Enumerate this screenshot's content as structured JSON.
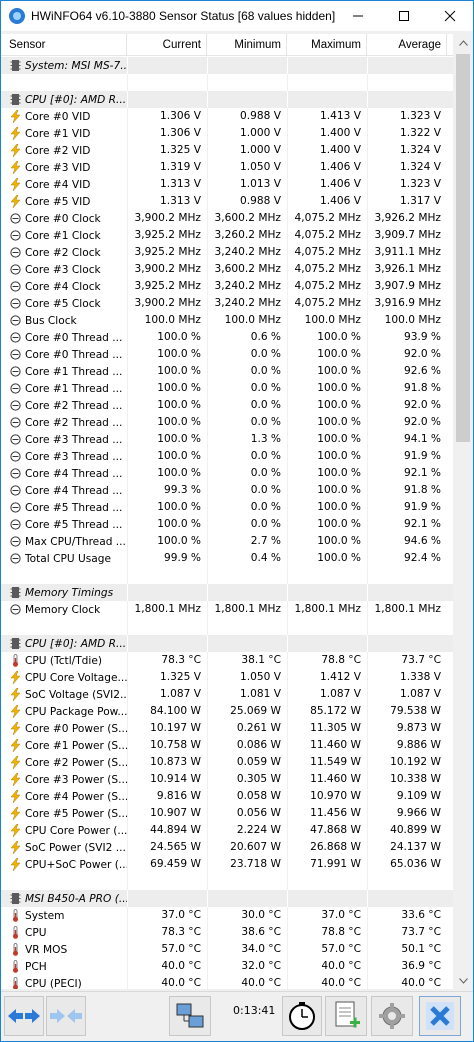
{
  "window": {
    "title": "HWiNFO64 v6.10-3880 Sensor Status [68 values hidden]",
    "minimize": "—",
    "maximize": "☐",
    "close": "✕"
  },
  "columns": {
    "sensor": "Sensor",
    "current": "Current",
    "minimum": "Minimum",
    "maximum": "Maximum",
    "average": "Average"
  },
  "rows": [
    {
      "type": "group",
      "icon": "chip-icon",
      "name": "System: MSI MS-7...",
      "cur": "",
      "min": "",
      "max": "",
      "avg": ""
    },
    {
      "type": "blank",
      "icon": "",
      "name": "",
      "cur": "",
      "min": "",
      "max": "",
      "avg": ""
    },
    {
      "type": "group",
      "icon": "chip-icon",
      "name": "CPU [#0]: AMD R...",
      "cur": "",
      "min": "",
      "max": "",
      "avg": ""
    },
    {
      "type": "item",
      "icon": "voltage-icon",
      "name": "Core #0 VID",
      "cur": "1.306 V",
      "min": "0.988 V",
      "max": "1.413 V",
      "avg": "1.323 V"
    },
    {
      "type": "item",
      "icon": "voltage-icon",
      "name": "Core #1 VID",
      "cur": "1.306 V",
      "min": "1.000 V",
      "max": "1.400 V",
      "avg": "1.322 V"
    },
    {
      "type": "item",
      "icon": "voltage-icon",
      "name": "Core #2 VID",
      "cur": "1.325 V",
      "min": "1.000 V",
      "max": "1.400 V",
      "avg": "1.324 V"
    },
    {
      "type": "item",
      "icon": "voltage-icon",
      "name": "Core #3 VID",
      "cur": "1.319 V",
      "min": "1.050 V",
      "max": "1.406 V",
      "avg": "1.324 V"
    },
    {
      "type": "item",
      "icon": "voltage-icon",
      "name": "Core #4 VID",
      "cur": "1.313 V",
      "min": "1.013 V",
      "max": "1.406 V",
      "avg": "1.323 V"
    },
    {
      "type": "item",
      "icon": "voltage-icon",
      "name": "Core #5 VID",
      "cur": "1.313 V",
      "min": "0.988 V",
      "max": "1.406 V",
      "avg": "1.317 V"
    },
    {
      "type": "item",
      "icon": "clock-icon",
      "name": "Core #0 Clock",
      "cur": "3,900.2 MHz",
      "min": "3,600.2 MHz",
      "max": "4,075.2 MHz",
      "avg": "3,926.2 MHz"
    },
    {
      "type": "item",
      "icon": "clock-icon",
      "name": "Core #1 Clock",
      "cur": "3,925.2 MHz",
      "min": "3,260.2 MHz",
      "max": "4,075.2 MHz",
      "avg": "3,909.7 MHz"
    },
    {
      "type": "item",
      "icon": "clock-icon",
      "name": "Core #2 Clock",
      "cur": "3,925.2 MHz",
      "min": "3,240.2 MHz",
      "max": "4,075.2 MHz",
      "avg": "3,911.1 MHz"
    },
    {
      "type": "item",
      "icon": "clock-icon",
      "name": "Core #3 Clock",
      "cur": "3,900.2 MHz",
      "min": "3,600.2 MHz",
      "max": "4,075.2 MHz",
      "avg": "3,926.1 MHz"
    },
    {
      "type": "item",
      "icon": "clock-icon",
      "name": "Core #4 Clock",
      "cur": "3,925.2 MHz",
      "min": "3,240.2 MHz",
      "max": "4,075.2 MHz",
      "avg": "3,907.9 MHz"
    },
    {
      "type": "item",
      "icon": "clock-icon",
      "name": "Core #5 Clock",
      "cur": "3,900.2 MHz",
      "min": "3,240.2 MHz",
      "max": "4,075.2 MHz",
      "avg": "3,916.9 MHz"
    },
    {
      "type": "item",
      "icon": "clock-icon",
      "name": "Bus Clock",
      "cur": "100.0 MHz",
      "min": "100.0 MHz",
      "max": "100.0 MHz",
      "avg": "100.0 MHz"
    },
    {
      "type": "item",
      "icon": "clock-icon",
      "name": "Core #0 Thread ...",
      "cur": "100.0 %",
      "min": "0.6 %",
      "max": "100.0 %",
      "avg": "93.9 %"
    },
    {
      "type": "item",
      "icon": "clock-icon",
      "name": "Core #0 Thread ...",
      "cur": "100.0 %",
      "min": "0.0 %",
      "max": "100.0 %",
      "avg": "92.0 %"
    },
    {
      "type": "item",
      "icon": "clock-icon",
      "name": "Core #1 Thread ...",
      "cur": "100.0 %",
      "min": "0.0 %",
      "max": "100.0 %",
      "avg": "92.6 %"
    },
    {
      "type": "item",
      "icon": "clock-icon",
      "name": "Core #1 Thread ...",
      "cur": "100.0 %",
      "min": "0.0 %",
      "max": "100.0 %",
      "avg": "91.8 %"
    },
    {
      "type": "item",
      "icon": "clock-icon",
      "name": "Core #2 Thread ...",
      "cur": "100.0 %",
      "min": "0.0 %",
      "max": "100.0 %",
      "avg": "92.0 %"
    },
    {
      "type": "item",
      "icon": "clock-icon",
      "name": "Core #2 Thread ...",
      "cur": "100.0 %",
      "min": "0.0 %",
      "max": "100.0 %",
      "avg": "92.0 %"
    },
    {
      "type": "item",
      "icon": "clock-icon",
      "name": "Core #3 Thread ...",
      "cur": "100.0 %",
      "min": "1.3 %",
      "max": "100.0 %",
      "avg": "94.1 %"
    },
    {
      "type": "item",
      "icon": "clock-icon",
      "name": "Core #3 Thread ...",
      "cur": "100.0 %",
      "min": "0.0 %",
      "max": "100.0 %",
      "avg": "91.9 %"
    },
    {
      "type": "item",
      "icon": "clock-icon",
      "name": "Core #4 Thread ...",
      "cur": "100.0 %",
      "min": "0.0 %",
      "max": "100.0 %",
      "avg": "92.1 %"
    },
    {
      "type": "item",
      "icon": "clock-icon",
      "name": "Core #4 Thread ...",
      "cur": "99.3 %",
      "min": "0.0 %",
      "max": "100.0 %",
      "avg": "91.8 %"
    },
    {
      "type": "item",
      "icon": "clock-icon",
      "name": "Core #5 Thread ...",
      "cur": "100.0 %",
      "min": "0.0 %",
      "max": "100.0 %",
      "avg": "91.9 %"
    },
    {
      "type": "item",
      "icon": "clock-icon",
      "name": "Core #5 Thread ...",
      "cur": "100.0 %",
      "min": "0.0 %",
      "max": "100.0 %",
      "avg": "92.1 %"
    },
    {
      "type": "item",
      "icon": "clock-icon",
      "name": "Max CPU/Thread ...",
      "cur": "100.0 %",
      "min": "2.7 %",
      "max": "100.0 %",
      "avg": "94.6 %"
    },
    {
      "type": "item",
      "icon": "clock-icon",
      "name": "Total CPU Usage",
      "cur": "99.9 %",
      "min": "0.4 %",
      "max": "100.0 %",
      "avg": "92.4 %"
    },
    {
      "type": "blank",
      "icon": "",
      "name": "",
      "cur": "",
      "min": "",
      "max": "",
      "avg": ""
    },
    {
      "type": "group",
      "icon": "chip-icon",
      "name": "Memory Timings",
      "cur": "",
      "min": "",
      "max": "",
      "avg": ""
    },
    {
      "type": "item",
      "icon": "clock-icon",
      "name": "Memory Clock",
      "cur": "1,800.1 MHz",
      "min": "1,800.1 MHz",
      "max": "1,800.1 MHz",
      "avg": "1,800.1 MHz"
    },
    {
      "type": "blank",
      "icon": "",
      "name": "",
      "cur": "",
      "min": "",
      "max": "",
      "avg": ""
    },
    {
      "type": "group",
      "icon": "chip-icon",
      "name": "CPU [#0]: AMD R...",
      "cur": "",
      "min": "",
      "max": "",
      "avg": ""
    },
    {
      "type": "item",
      "icon": "thermometer-icon",
      "name": "CPU (Tctl/Tdie)",
      "cur": "78.3 °C",
      "min": "38.1 °C",
      "max": "78.8 °C",
      "avg": "73.7 °C"
    },
    {
      "type": "item",
      "icon": "voltage-icon",
      "name": "CPU Core Voltage...",
      "cur": "1.325 V",
      "min": "1.050 V",
      "max": "1.412 V",
      "avg": "1.338 V"
    },
    {
      "type": "item",
      "icon": "voltage-icon",
      "name": "SoC Voltage (SVI2...",
      "cur": "1.087 V",
      "min": "1.081 V",
      "max": "1.087 V",
      "avg": "1.087 V"
    },
    {
      "type": "item",
      "icon": "voltage-icon",
      "name": "CPU Package Pow...",
      "cur": "84.100 W",
      "min": "25.069 W",
      "max": "85.172 W",
      "avg": "79.538 W"
    },
    {
      "type": "item",
      "icon": "voltage-icon",
      "name": "Core #0 Power (S...",
      "cur": "10.197 W",
      "min": "0.261 W",
      "max": "11.305 W",
      "avg": "9.873 W"
    },
    {
      "type": "item",
      "icon": "voltage-icon",
      "name": "Core #1 Power (S...",
      "cur": "10.758 W",
      "min": "0.086 W",
      "max": "11.460 W",
      "avg": "9.886 W"
    },
    {
      "type": "item",
      "icon": "voltage-icon",
      "name": "Core #2 Power (S...",
      "cur": "10.873 W",
      "min": "0.059 W",
      "max": "11.549 W",
      "avg": "10.192 W"
    },
    {
      "type": "item",
      "icon": "voltage-icon",
      "name": "Core #3 Power (S...",
      "cur": "10.914 W",
      "min": "0.305 W",
      "max": "11.460 W",
      "avg": "10.338 W"
    },
    {
      "type": "item",
      "icon": "voltage-icon",
      "name": "Core #4 Power (S...",
      "cur": "9.816 W",
      "min": "0.058 W",
      "max": "10.970 W",
      "avg": "9.109 W"
    },
    {
      "type": "item",
      "icon": "voltage-icon",
      "name": "Core #5 Power (S...",
      "cur": "10.907 W",
      "min": "0.056 W",
      "max": "11.456 W",
      "avg": "9.966 W"
    },
    {
      "type": "item",
      "icon": "voltage-icon",
      "name": "CPU Core Power (...",
      "cur": "44.894 W",
      "min": "2.224 W",
      "max": "47.868 W",
      "avg": "40.899 W"
    },
    {
      "type": "item",
      "icon": "voltage-icon",
      "name": "SoC Power (SVI2 ...",
      "cur": "24.565 W",
      "min": "20.607 W",
      "max": "26.868 W",
      "avg": "24.137 W"
    },
    {
      "type": "item",
      "icon": "voltage-icon",
      "name": "CPU+SoC Power (...",
      "cur": "69.459 W",
      "min": "23.718 W",
      "max": "71.991 W",
      "avg": "65.036 W"
    },
    {
      "type": "blank",
      "icon": "",
      "name": "",
      "cur": "",
      "min": "",
      "max": "",
      "avg": ""
    },
    {
      "type": "group",
      "icon": "chip-icon",
      "name": "MSI B450-A PRO (...",
      "cur": "",
      "min": "",
      "max": "",
      "avg": ""
    },
    {
      "type": "item",
      "icon": "thermometer-icon",
      "name": "System",
      "cur": "37.0 °C",
      "min": "30.0 °C",
      "max": "37.0 °C",
      "avg": "33.6 °C"
    },
    {
      "type": "item",
      "icon": "thermometer-icon",
      "name": "CPU",
      "cur": "78.3 °C",
      "min": "38.6 °C",
      "max": "78.8 °C",
      "avg": "73.7 °C"
    },
    {
      "type": "item",
      "icon": "thermometer-icon",
      "name": "VR MOS",
      "cur": "57.0 °C",
      "min": "34.0 °C",
      "max": "57.0 °C",
      "avg": "50.1 °C"
    },
    {
      "type": "item",
      "icon": "thermometer-icon",
      "name": "PCH",
      "cur": "40.0 °C",
      "min": "32.0 °C",
      "max": "40.0 °C",
      "avg": "36.9 °C"
    },
    {
      "type": "item",
      "icon": "thermometer-icon",
      "name": "CPU (PECI)",
      "cur": "40.0 °C",
      "min": "40.0 °C",
      "max": "40.0 °C",
      "avg": "40.0 °C"
    }
  ],
  "toolbar": {
    "timer": "0:13:41",
    "icons": [
      "nav-left-right-icon",
      "nav-right-left-icon",
      "network-icon",
      "stopwatch-icon",
      "add-report-icon",
      "settings-gear-icon",
      "close-x-icon"
    ]
  },
  "colors": {
    "accent": "#1883d7",
    "voltage_icon": "#f0b400",
    "thermometer_icon": "#c0392b",
    "close_button": "#2b7bd6"
  }
}
